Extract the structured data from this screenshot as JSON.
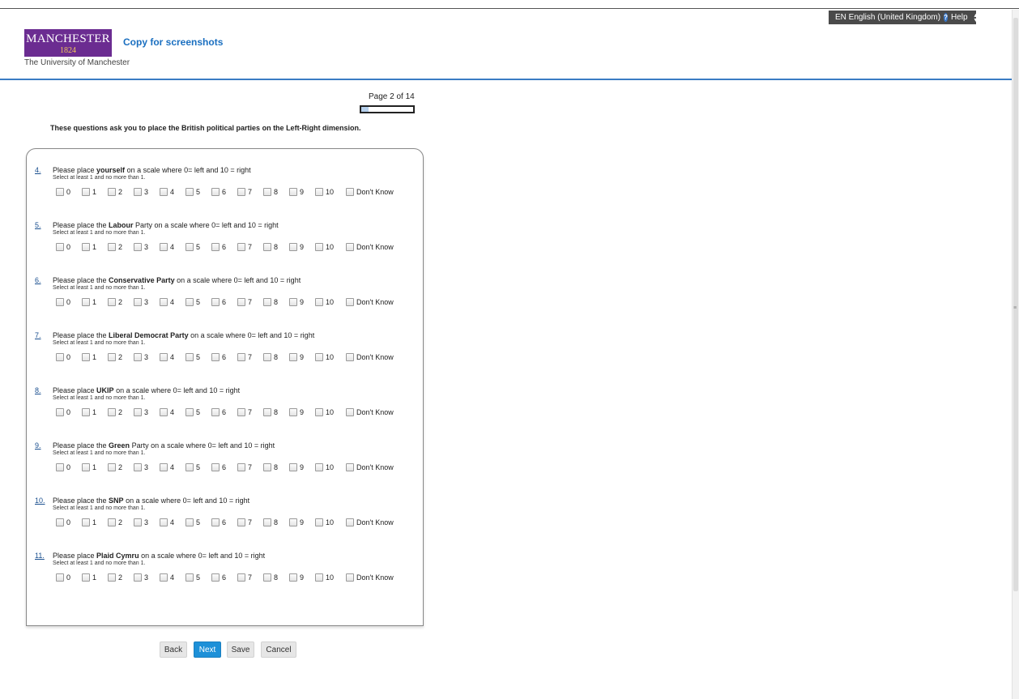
{
  "header": {
    "language_label": "EN English (United Kingdom)",
    "help_label": "Help",
    "logo_name": "MANCHESTER",
    "logo_year": "1824",
    "logo_caption": "The University of Manchester",
    "survey_title": "Copy for screenshots"
  },
  "progress": {
    "page_text": "Page 2 of 14",
    "fraction": 0.143
  },
  "intro_text": "These questions ask you to place the British political parties on the Left-Right dimension.",
  "hint_text": "Select at least 1 and no more than 1.",
  "options": [
    "0",
    "1",
    "2",
    "3",
    "4",
    "5",
    "6",
    "7",
    "8",
    "9",
    "10",
    "Don't Know"
  ],
  "questions": [
    {
      "number": "4.",
      "prefix": "Please place ",
      "bold": "yourself",
      "suffix": " on a scale where 0= left and 10 = right"
    },
    {
      "number": "5.",
      "prefix": "Please place the ",
      "bold": "Labour",
      "suffix": " Party on a scale where 0= left and 10 = right"
    },
    {
      "number": "6.",
      "prefix": "Please place the ",
      "bold": "Conservative Party",
      "suffix": " on a scale where 0= left and 10 = right"
    },
    {
      "number": "7.",
      "prefix": "Please place the ",
      "bold": "Liberal Democrat Party",
      "suffix": " on a scale where 0= left and 10 = right"
    },
    {
      "number": "8.",
      "prefix": "Please place ",
      "bold": "UKIP",
      "suffix": " on a scale where 0= left and 10 = right"
    },
    {
      "number": "9.",
      "prefix": "Please place the ",
      "bold": "Green",
      "suffix": " Party on a scale where 0= left and 10 = right"
    },
    {
      "number": "10.",
      "prefix": "Please place the ",
      "bold": "SNP",
      "suffix": " on a scale where 0= left and 10 = right"
    },
    {
      "number": "11.",
      "prefix": "Please place ",
      "bold": "Plaid Cymru",
      "suffix": " on a scale where 0= left and 10 = right"
    }
  ],
  "buttons": {
    "back": "Back",
    "next": "Next",
    "save": "Save",
    "cancel": "Cancel"
  },
  "colors": {
    "brand_purple": "#6b2c91",
    "brand_gold": "#f2c75c",
    "accent_blue": "#1d90d8",
    "link_blue": "#1a6fc0"
  }
}
